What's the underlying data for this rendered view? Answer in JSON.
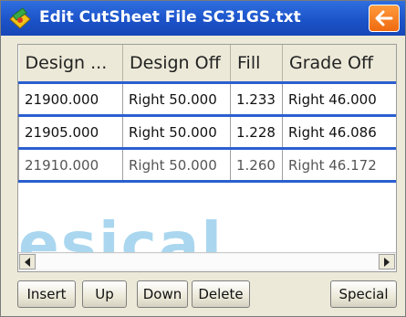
{
  "window": {
    "title": "Edit CutSheet File  SC31GS.txt",
    "icon": "app-icon",
    "back_icon": "back-arrow-icon",
    "accent_color": "#f07a1c",
    "titlebar_color": "#1c53c9"
  },
  "table": {
    "columns": [
      "Design ...",
      "Design Off",
      "Fill",
      "Grade Off"
    ],
    "rows": [
      [
        "21900.000",
        "Right 50.000",
        "1.233",
        "Right 46.000"
      ],
      [
        "21905.000",
        "Right 50.000",
        "1.228",
        "Right 46.086"
      ],
      [
        "21910.000",
        "Right 50.000",
        "1.260",
        "Right 46.172"
      ]
    ],
    "selection_color": "#2b5fd0"
  },
  "watermark": {
    "text": "esical"
  },
  "buttons": {
    "insert": "Insert",
    "up": "Up",
    "down": "Down",
    "delete": "Delete",
    "special": "Special"
  }
}
